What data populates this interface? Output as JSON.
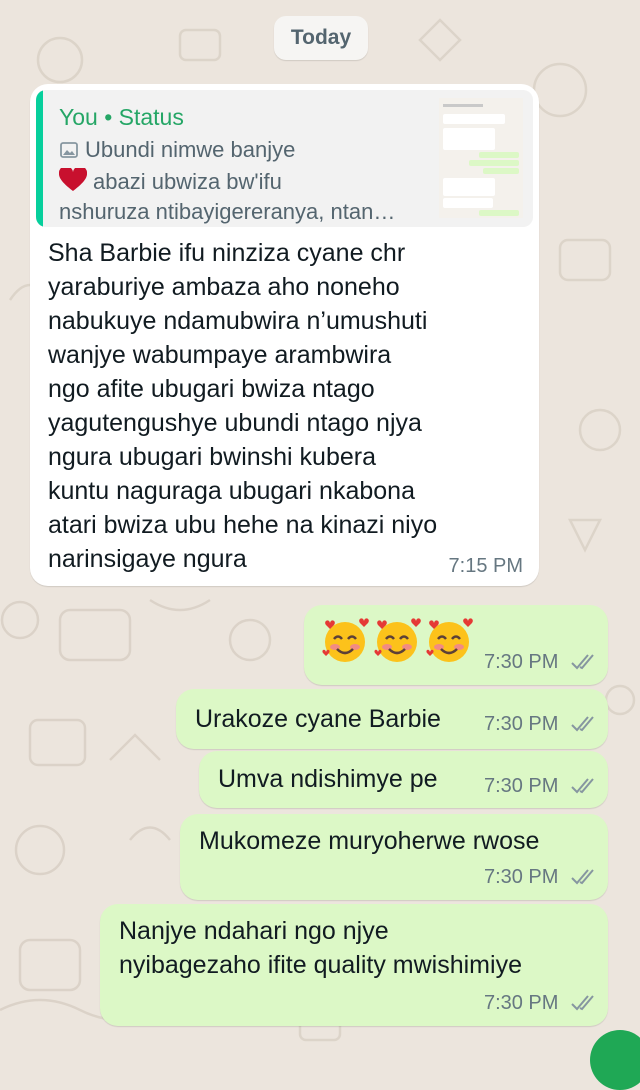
{
  "date_chip": "Today",
  "incoming": {
    "quote": {
      "author": "You • Status",
      "lines": [
        "Ubundi nimwe banjye",
        "abazi ubwiza bw'ifu",
        "nshuruza ntibayigereranya, ntan…"
      ],
      "icons": [
        "image-icon",
        "heart-icon"
      ]
    },
    "text": "Sha Barbie ifu ninziza cyane chr\nyaraburiye ambaza aho noneho\nnabukuye ndamubwira n’umushuti\nwanjye wabumpaye arambwira\nngo afite ubugari bwiza ntago\nyagutengushye ubundi ntago njya\nngura ubugari bwinshi kubera\nkuntu naguraga ubugari nkabona\natari bwiza ubu hehe na kinazi niyo\nnarinsigaye ngura",
    "time": "7:15 PM"
  },
  "outgoing": [
    {
      "text": "🥰🥰🥰",
      "time": "7:30 PM"
    },
    {
      "text": "Urakoze cyane Barbie",
      "time": "7:30 PM"
    },
    {
      "text": "Umva ndishimye pe",
      "time": "7:30 PM"
    },
    {
      "text": "Mukomeze muryoherwe rwose",
      "time": "7:30 PM"
    },
    {
      "text": "Nanjye ndahari ngo njye\nnyibagezaho ifite quality mwishimiye",
      "time": "7:30 PM"
    }
  ],
  "colors": {
    "wallpaper": "#ece5dd",
    "outgoing_bubble": "#dcf8c6",
    "incoming_bubble": "#ffffff",
    "quote_accent": "#06cf9c",
    "quote_author": "#25a666",
    "read_ticks": "#8696a0"
  }
}
